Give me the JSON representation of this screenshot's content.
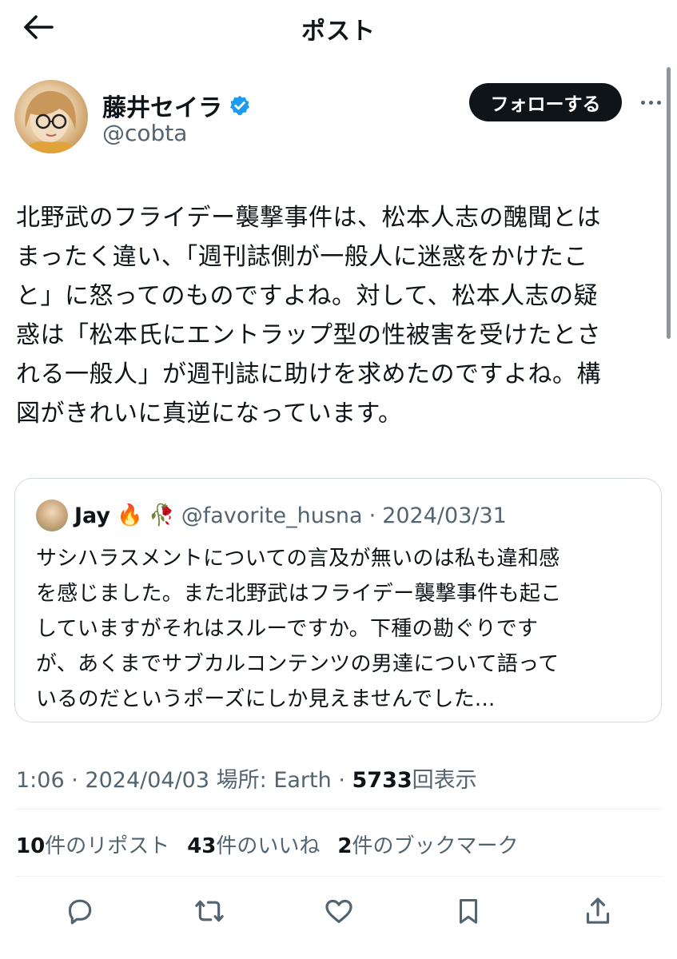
{
  "header": {
    "title": "ポスト"
  },
  "author": {
    "display_name": "藤井セイラ",
    "handle": "@cobta",
    "verified": true
  },
  "follow_button": "フォローする",
  "tweet": {
    "text": "北野武のフライデー襲撃事件は、松本人志の醜聞とは\nまったく違い、「週刊誌側が一般人に迷惑をかけたこ\nと」に怒ってのものですよね。対して、松本人志の疑\n惑は「松本氏にエントラップ型の性被害を受けたとさ\nれる一般人」が週刊誌に助けを求めたのですよね。構\n図がきれいに真逆になっています。"
  },
  "quote": {
    "name": "Jay",
    "emojis": [
      "🔥",
      "🥀"
    ],
    "handle": "@favorite_husna",
    "separator": "·",
    "date": "2024/03/31",
    "text": "サシハラスメントについての言及が無いのは私も違和感\nを感じました。また北野武はフライデー襲撃事件も起こ\nしていますがそれはスルーですか。下種の勘ぐりです\nが、あくまでサブカルコンテンツの男達について語って\nいるのだというポーズにしか見えませんでした..."
  },
  "meta": {
    "time": "1:06",
    "separator": "·",
    "date": "2024/04/03",
    "location": "場所: Earth",
    "views_count": "5733",
    "views_label": "回表示"
  },
  "stats": [
    {
      "count": "10",
      "label": "件のリポスト"
    },
    {
      "count": "43",
      "label": "件のいいね"
    },
    {
      "count": "2",
      "label": "件のブックマーク"
    }
  ],
  "actions": [
    "reply-icon",
    "repost-icon",
    "like-icon",
    "bookmark-icon",
    "share-icon"
  ],
  "colors": {
    "text": "#0f1419",
    "secondary": "#536471",
    "verified": "#1d9bf0",
    "border": "#cfd9de"
  }
}
